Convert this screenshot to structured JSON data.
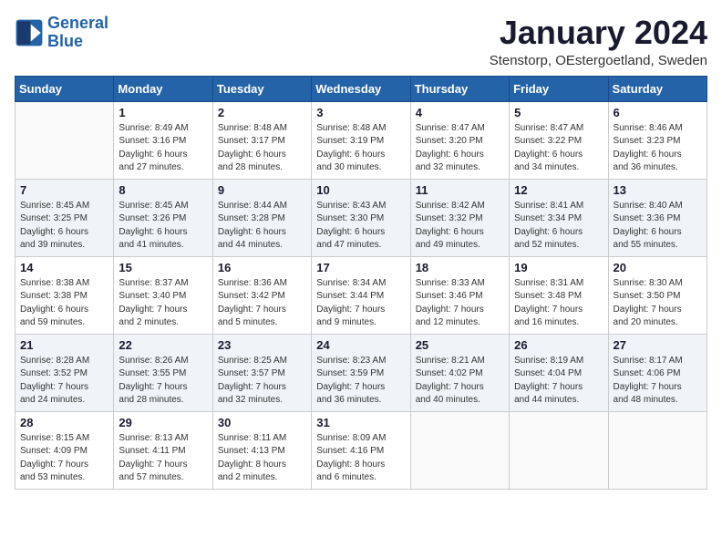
{
  "header": {
    "logo_line1": "General",
    "logo_line2": "Blue",
    "month": "January 2024",
    "location": "Stenstorp, OEstergoetland, Sweden"
  },
  "weekdays": [
    "Sunday",
    "Monday",
    "Tuesday",
    "Wednesday",
    "Thursday",
    "Friday",
    "Saturday"
  ],
  "weeks": [
    [
      {
        "day": "",
        "info": ""
      },
      {
        "day": "1",
        "info": "Sunrise: 8:49 AM\nSunset: 3:16 PM\nDaylight: 6 hours\nand 27 minutes."
      },
      {
        "day": "2",
        "info": "Sunrise: 8:48 AM\nSunset: 3:17 PM\nDaylight: 6 hours\nand 28 minutes."
      },
      {
        "day": "3",
        "info": "Sunrise: 8:48 AM\nSunset: 3:19 PM\nDaylight: 6 hours\nand 30 minutes."
      },
      {
        "day": "4",
        "info": "Sunrise: 8:47 AM\nSunset: 3:20 PM\nDaylight: 6 hours\nand 32 minutes."
      },
      {
        "day": "5",
        "info": "Sunrise: 8:47 AM\nSunset: 3:22 PM\nDaylight: 6 hours\nand 34 minutes."
      },
      {
        "day": "6",
        "info": "Sunrise: 8:46 AM\nSunset: 3:23 PM\nDaylight: 6 hours\nand 36 minutes."
      }
    ],
    [
      {
        "day": "7",
        "info": "Sunrise: 8:45 AM\nSunset: 3:25 PM\nDaylight: 6 hours\nand 39 minutes."
      },
      {
        "day": "8",
        "info": "Sunrise: 8:45 AM\nSunset: 3:26 PM\nDaylight: 6 hours\nand 41 minutes."
      },
      {
        "day": "9",
        "info": "Sunrise: 8:44 AM\nSunset: 3:28 PM\nDaylight: 6 hours\nand 44 minutes."
      },
      {
        "day": "10",
        "info": "Sunrise: 8:43 AM\nSunset: 3:30 PM\nDaylight: 6 hours\nand 47 minutes."
      },
      {
        "day": "11",
        "info": "Sunrise: 8:42 AM\nSunset: 3:32 PM\nDaylight: 6 hours\nand 49 minutes."
      },
      {
        "day": "12",
        "info": "Sunrise: 8:41 AM\nSunset: 3:34 PM\nDaylight: 6 hours\nand 52 minutes."
      },
      {
        "day": "13",
        "info": "Sunrise: 8:40 AM\nSunset: 3:36 PM\nDaylight: 6 hours\nand 55 minutes."
      }
    ],
    [
      {
        "day": "14",
        "info": "Sunrise: 8:38 AM\nSunset: 3:38 PM\nDaylight: 6 hours\nand 59 minutes."
      },
      {
        "day": "15",
        "info": "Sunrise: 8:37 AM\nSunset: 3:40 PM\nDaylight: 7 hours\nand 2 minutes."
      },
      {
        "day": "16",
        "info": "Sunrise: 8:36 AM\nSunset: 3:42 PM\nDaylight: 7 hours\nand 5 minutes."
      },
      {
        "day": "17",
        "info": "Sunrise: 8:34 AM\nSunset: 3:44 PM\nDaylight: 7 hours\nand 9 minutes."
      },
      {
        "day": "18",
        "info": "Sunrise: 8:33 AM\nSunset: 3:46 PM\nDaylight: 7 hours\nand 12 minutes."
      },
      {
        "day": "19",
        "info": "Sunrise: 8:31 AM\nSunset: 3:48 PM\nDaylight: 7 hours\nand 16 minutes."
      },
      {
        "day": "20",
        "info": "Sunrise: 8:30 AM\nSunset: 3:50 PM\nDaylight: 7 hours\nand 20 minutes."
      }
    ],
    [
      {
        "day": "21",
        "info": "Sunrise: 8:28 AM\nSunset: 3:52 PM\nDaylight: 7 hours\nand 24 minutes."
      },
      {
        "day": "22",
        "info": "Sunrise: 8:26 AM\nSunset: 3:55 PM\nDaylight: 7 hours\nand 28 minutes."
      },
      {
        "day": "23",
        "info": "Sunrise: 8:25 AM\nSunset: 3:57 PM\nDaylight: 7 hours\nand 32 minutes."
      },
      {
        "day": "24",
        "info": "Sunrise: 8:23 AM\nSunset: 3:59 PM\nDaylight: 7 hours\nand 36 minutes."
      },
      {
        "day": "25",
        "info": "Sunrise: 8:21 AM\nSunset: 4:02 PM\nDaylight: 7 hours\nand 40 minutes."
      },
      {
        "day": "26",
        "info": "Sunrise: 8:19 AM\nSunset: 4:04 PM\nDaylight: 7 hours\nand 44 minutes."
      },
      {
        "day": "27",
        "info": "Sunrise: 8:17 AM\nSunset: 4:06 PM\nDaylight: 7 hours\nand 48 minutes."
      }
    ],
    [
      {
        "day": "28",
        "info": "Sunrise: 8:15 AM\nSunset: 4:09 PM\nDaylight: 7 hours\nand 53 minutes."
      },
      {
        "day": "29",
        "info": "Sunrise: 8:13 AM\nSunset: 4:11 PM\nDaylight: 7 hours\nand 57 minutes."
      },
      {
        "day": "30",
        "info": "Sunrise: 8:11 AM\nSunset: 4:13 PM\nDaylight: 8 hours\nand 2 minutes."
      },
      {
        "day": "31",
        "info": "Sunrise: 8:09 AM\nSunset: 4:16 PM\nDaylight: 8 hours\nand 6 minutes."
      },
      {
        "day": "",
        "info": ""
      },
      {
        "day": "",
        "info": ""
      },
      {
        "day": "",
        "info": ""
      }
    ]
  ]
}
